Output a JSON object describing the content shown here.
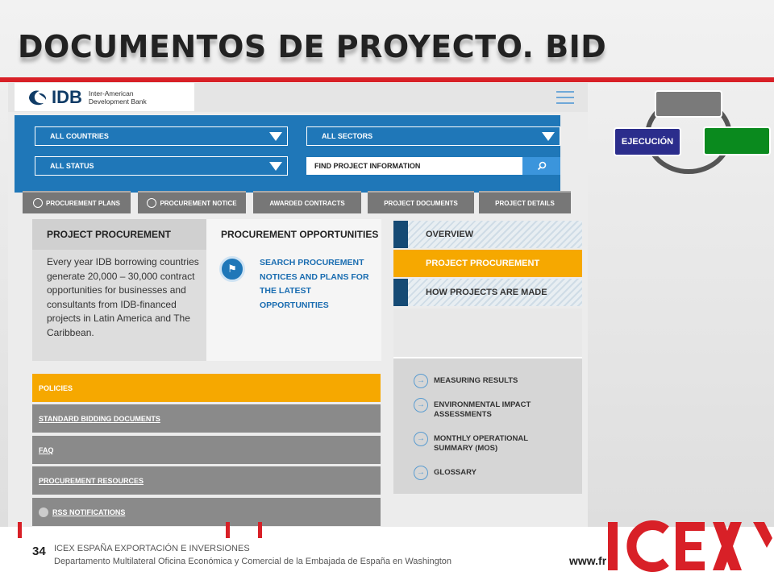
{
  "slide": {
    "title": "DOCUMENTOS DE PROYECTO. BID",
    "cycle_label": "EJECUCIÓN",
    "page_number": "34",
    "footer_org": "ICEX ESPAÑA EXPORTACIÓN  E INVERSIONES",
    "footer_dept": "Departamento Multilateral Oficina Económica y Comercial de la Embajada de España en Washington",
    "footer_url": "www.fr",
    "brand_logo_text": "ICEX",
    "colors": {
      "accent_red": "#d82027",
      "idb_blue": "#1f77b8",
      "highlight_orange": "#f6a800",
      "cycle_blue": "#2b2d8c",
      "cycle_green": "#0a8a1e"
    }
  },
  "site": {
    "logo": {
      "abbr": "IDB",
      "name_line1": "Inter-American",
      "name_line2": "Development Bank"
    },
    "filters": {
      "countries": "ALL COUNTRIES",
      "sectors": "ALL SECTORS",
      "status": "ALL STATUS"
    },
    "search": {
      "placeholder": "FIND PROJECT INFORMATION",
      "icon": "search-icon"
    },
    "tabs": [
      "PROCUREMENT PLANS",
      "PROCUREMENT NOTICE",
      "AWARDED CONTRACTS",
      "PROJECT DOCUMENTS",
      "PROJECT DETAILS"
    ],
    "procurement": {
      "left_heading": "PROJECT PROCUREMENT",
      "right_heading": "PROCUREMENT OPPORTUNITIES",
      "body": "Every year IDB borrowing countries generate 20,000 – 30,000 contract opportunities for businesses and consultants from IDB-financed projects in Latin America and The Caribbean.",
      "search_link": "SEARCH PROCUREMENT NOTICES AND PLANS FOR THE LATEST OPPORTUNITIES"
    },
    "right_menu": [
      "OVERVIEW",
      "PROJECT PROCUREMENT",
      "HOW PROJECTS ARE MADE"
    ],
    "right_links": [
      "MEASURING RESULTS",
      "ENVIRONMENTAL IMPACT ASSESSMENTS",
      "MONTHLY OPERATIONAL SUMMARY (MOS)",
      "GLOSSARY"
    ],
    "left_list": [
      "POLICIES",
      "STANDARD BIDDING DOCUMENTS",
      "FAQ",
      "PROCUREMENT RESOURCES",
      "RSS NOTIFICATIONS"
    ]
  }
}
